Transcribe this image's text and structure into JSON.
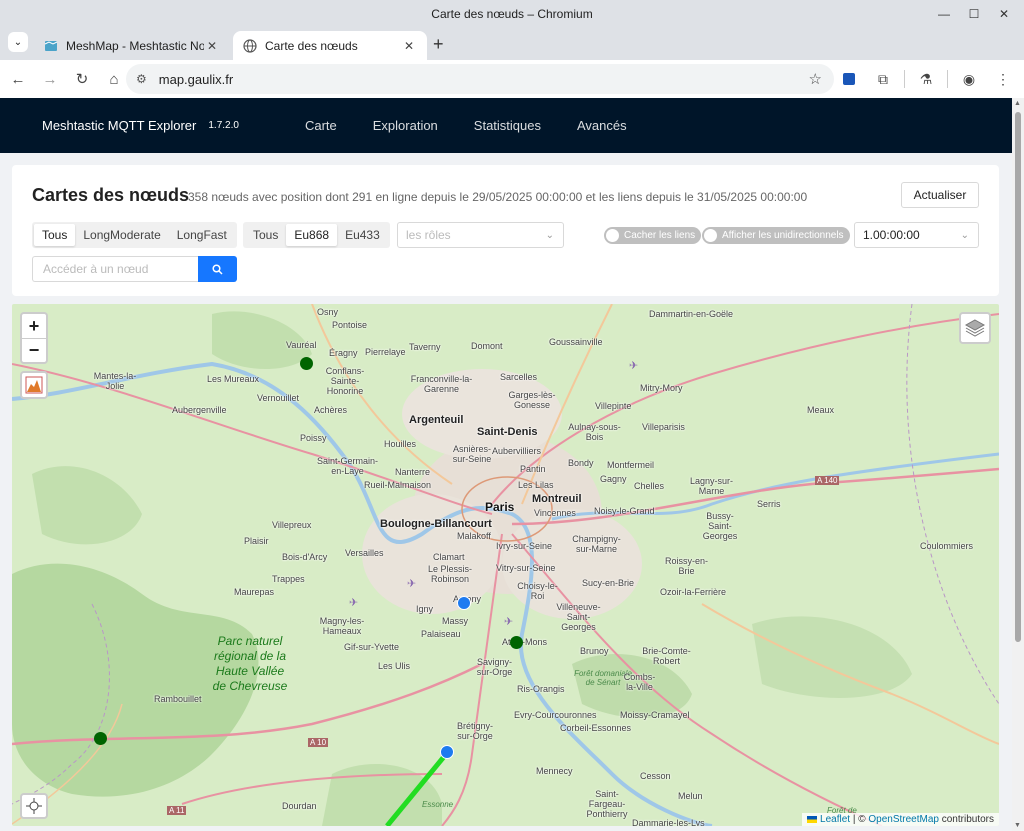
{
  "window": {
    "title": "Carte des nœuds – Chromium"
  },
  "tabs": [
    {
      "label": "MeshMap - Meshtastic Node",
      "close": "✕"
    },
    {
      "label": "Carte des nœuds",
      "close": "✕"
    }
  ],
  "address": {
    "url": "map.gaulix.fr"
  },
  "app": {
    "brand": "Meshtastic MQTT Explorer",
    "version": "1.7.2.0",
    "menu": [
      "Carte",
      "Exploration",
      "Statistiques",
      "Avancés"
    ]
  },
  "card": {
    "title": "Cartes des nœuds",
    "subtitle": "358 nœuds avec position dont 291 en ligne depuis le 29/05/2025 00:00:00 et les liens depuis le 31/05/2025 00:00:00",
    "refresh": "Actualiser",
    "preset_filter": [
      "Tous",
      "LongModerate",
      "LongFast"
    ],
    "region_filter": [
      "Tous",
      "Eu868",
      "Eu433"
    ],
    "roles_placeholder": "les rôles",
    "toggle_hide_links": "Cacher les liens",
    "toggle_unidirectional": "Afficher les unidirectionnels",
    "duration": "1.00:00:00",
    "search_placeholder": "Accéder à un nœud"
  },
  "map": {
    "zoom_in": "+",
    "zoom_out": "−",
    "attribution": {
      "leaflet": "Leaflet",
      "sep": " | © ",
      "osm": "OpenStreetMap",
      "contrib": " contributors"
    },
    "labels": {
      "osny": "Osny",
      "pontoise": "Pontoise",
      "vaureal": "Vauréal",
      "eragny": "Éragny",
      "pierrelaye": "Pierrelaye",
      "taverny": "Taverny",
      "domont": "Domont",
      "goussainville": "Goussainville",
      "dammartin": "Dammartin-en-Goële",
      "mantes": "Mantes-la-Jolie",
      "mureaux": "Les Mureaux",
      "conflans": "Conflans-Sainte-Honorine",
      "franconville": "Franconville-la-Garenne",
      "sarcelles": "Sarcelles",
      "mitry": "Mitry-Mory",
      "aubergenville": "Aubergenville",
      "vernouillet": "Vernouillet",
      "acheres": "Achères",
      "garges": "Garges-lès-Gonesse",
      "villepinte": "Villepinte",
      "meaux": "Meaux",
      "argenteuil": "Argenteuil",
      "poissy": "Poissy",
      "houilles": "Houilles",
      "saintdenis": "Saint-Denis",
      "aulnay": "Aulnay-sous-Bois",
      "villeparisis": "Villeparisis",
      "asnieres": "Asnières-sur-Seine",
      "aubervilliers": "Aubervilliers",
      "pantin": "Pantin",
      "bondy": "Bondy",
      "montfermeil": "Montfermeil",
      "saintgermain": "Saint-Germain-en-Laye",
      "nanterre": "Nanterre",
      "rueil": "Rueil-Malmaison",
      "lilas": "Les Lilas",
      "gagny": "Gagny",
      "chelles": "Chelles",
      "lagny": "Lagny-sur-Marne",
      "montreuil": "Montreuil",
      "paris": "Paris",
      "vincennes": "Vincennes",
      "noisy": "Noisy-le-Grand",
      "bussy": "Bussy-Saint-Georges",
      "serris": "Serris",
      "boulogne": "Boulogne-Billancourt",
      "villepreux": "Villepreux",
      "plaisir": "Plaisir",
      "malakoff": "Malakoff",
      "ivry": "Ivry-sur-Seine",
      "champigny": "Champigny-sur-Marne",
      "boisdarcy": "Bois-d'Arcy",
      "versailles": "Versailles",
      "clamart": "Clamart",
      "roissy": "Roissy-en-Brie",
      "coulommiers": "Coulommiers",
      "trappes": "Trappes",
      "plessis": "Le Plessis-Robinson",
      "vitry": "Vitry-sur-Seine",
      "choisy": "Choisy-le-Roi",
      "sucy": "Sucy-en-Brie",
      "ozoir": "Ozoir-la-Ferrière",
      "maurepas": "Maurepas",
      "igny": "Igny",
      "antony": "Antony",
      "massy": "Massy",
      "villeneuve": "Villeneuve-Saint-Georges",
      "magny": "Magny-les-Hameaux",
      "palaiseau": "Palaiseau",
      "athismons": "Athis-Mons",
      "gif": "Gif-sur-Yvette",
      "ulis": "Les Ulis",
      "brunoy": "Brunoy",
      "brie": "Brie-Comte-Robert",
      "park": "Parc naturel régional de la Haute Vallée de Chevreuse",
      "savigny": "Savigny-sur-Orge",
      "senart": "Forêt domaniale de Sénart",
      "combs": "Combs-la-Ville",
      "risorangis": "Ris-Orangis",
      "rambouillet": "Rambouillet",
      "evry": "Evry-Courcouronnes",
      "moissy": "Moissy-Cramayel",
      "bretigny": "Brétigny-sur-Orge",
      "corbeil": "Corbeil-Essonnes",
      "a10": "A 10",
      "a140": "A 140",
      "a11": "A 11",
      "mennecy": "Mennecy",
      "cesson": "Cesson",
      "dourdan": "Dourdan",
      "saintfargeau": "Saint-Fargeau-Ponthierry",
      "melun": "Melun",
      "essonne": "Essonne",
      "foret": "Forêt de",
      "dammarie": "Dammarie-les-Lys"
    }
  },
  "colors": {
    "header_bg": "#001529",
    "primary": "#1677ff",
    "node_online": "#006400",
    "node_selected": "#1e7bf0",
    "link": "#22dd22"
  },
  "icons": {
    "back": "arrow-left-icon",
    "forward": "arrow-right-icon",
    "reload": "reload-icon",
    "home": "home-icon",
    "search": "search-icon",
    "layers": "layers-icon"
  }
}
